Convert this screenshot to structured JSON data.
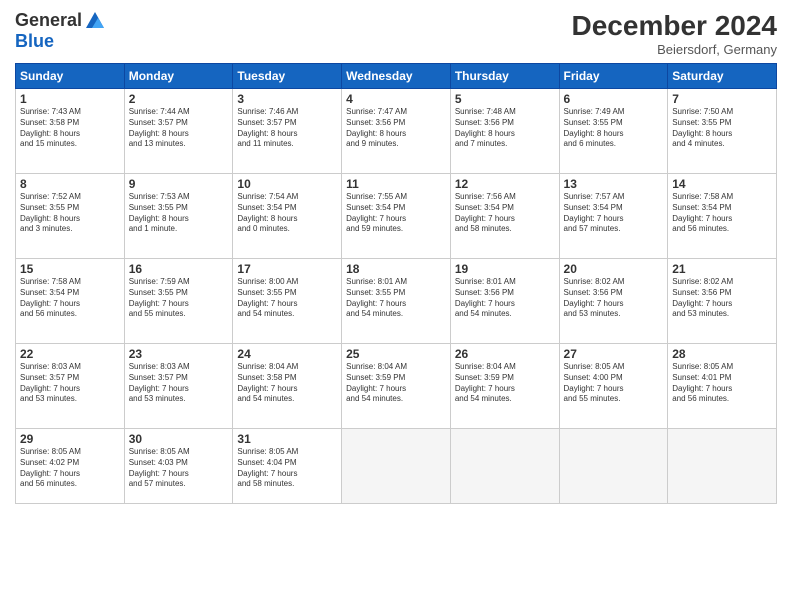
{
  "header": {
    "logo_general": "General",
    "logo_blue": "Blue",
    "month_title": "December 2024",
    "location": "Beiersdorf, Germany"
  },
  "weekdays": [
    "Sunday",
    "Monday",
    "Tuesday",
    "Wednesday",
    "Thursday",
    "Friday",
    "Saturday"
  ],
  "weeks": [
    [
      {
        "day": 1,
        "info": "Sunrise: 7:43 AM\nSunset: 3:58 PM\nDaylight: 8 hours\nand 15 minutes."
      },
      {
        "day": 2,
        "info": "Sunrise: 7:44 AM\nSunset: 3:57 PM\nDaylight: 8 hours\nand 13 minutes."
      },
      {
        "day": 3,
        "info": "Sunrise: 7:46 AM\nSunset: 3:57 PM\nDaylight: 8 hours\nand 11 minutes."
      },
      {
        "day": 4,
        "info": "Sunrise: 7:47 AM\nSunset: 3:56 PM\nDaylight: 8 hours\nand 9 minutes."
      },
      {
        "day": 5,
        "info": "Sunrise: 7:48 AM\nSunset: 3:56 PM\nDaylight: 8 hours\nand 7 minutes."
      },
      {
        "day": 6,
        "info": "Sunrise: 7:49 AM\nSunset: 3:55 PM\nDaylight: 8 hours\nand 6 minutes."
      },
      {
        "day": 7,
        "info": "Sunrise: 7:50 AM\nSunset: 3:55 PM\nDaylight: 8 hours\nand 4 minutes."
      }
    ],
    [
      {
        "day": 8,
        "info": "Sunrise: 7:52 AM\nSunset: 3:55 PM\nDaylight: 8 hours\nand 3 minutes."
      },
      {
        "day": 9,
        "info": "Sunrise: 7:53 AM\nSunset: 3:55 PM\nDaylight: 8 hours\nand 1 minute."
      },
      {
        "day": 10,
        "info": "Sunrise: 7:54 AM\nSunset: 3:54 PM\nDaylight: 8 hours\nand 0 minutes."
      },
      {
        "day": 11,
        "info": "Sunrise: 7:55 AM\nSunset: 3:54 PM\nDaylight: 7 hours\nand 59 minutes."
      },
      {
        "day": 12,
        "info": "Sunrise: 7:56 AM\nSunset: 3:54 PM\nDaylight: 7 hours\nand 58 minutes."
      },
      {
        "day": 13,
        "info": "Sunrise: 7:57 AM\nSunset: 3:54 PM\nDaylight: 7 hours\nand 57 minutes."
      },
      {
        "day": 14,
        "info": "Sunrise: 7:58 AM\nSunset: 3:54 PM\nDaylight: 7 hours\nand 56 minutes."
      }
    ],
    [
      {
        "day": 15,
        "info": "Sunrise: 7:58 AM\nSunset: 3:54 PM\nDaylight: 7 hours\nand 56 minutes."
      },
      {
        "day": 16,
        "info": "Sunrise: 7:59 AM\nSunset: 3:55 PM\nDaylight: 7 hours\nand 55 minutes."
      },
      {
        "day": 17,
        "info": "Sunrise: 8:00 AM\nSunset: 3:55 PM\nDaylight: 7 hours\nand 54 minutes."
      },
      {
        "day": 18,
        "info": "Sunrise: 8:01 AM\nSunset: 3:55 PM\nDaylight: 7 hours\nand 54 minutes."
      },
      {
        "day": 19,
        "info": "Sunrise: 8:01 AM\nSunset: 3:56 PM\nDaylight: 7 hours\nand 54 minutes."
      },
      {
        "day": 20,
        "info": "Sunrise: 8:02 AM\nSunset: 3:56 PM\nDaylight: 7 hours\nand 53 minutes."
      },
      {
        "day": 21,
        "info": "Sunrise: 8:02 AM\nSunset: 3:56 PM\nDaylight: 7 hours\nand 53 minutes."
      }
    ],
    [
      {
        "day": 22,
        "info": "Sunrise: 8:03 AM\nSunset: 3:57 PM\nDaylight: 7 hours\nand 53 minutes."
      },
      {
        "day": 23,
        "info": "Sunrise: 8:03 AM\nSunset: 3:57 PM\nDaylight: 7 hours\nand 53 minutes."
      },
      {
        "day": 24,
        "info": "Sunrise: 8:04 AM\nSunset: 3:58 PM\nDaylight: 7 hours\nand 54 minutes."
      },
      {
        "day": 25,
        "info": "Sunrise: 8:04 AM\nSunset: 3:59 PM\nDaylight: 7 hours\nand 54 minutes."
      },
      {
        "day": 26,
        "info": "Sunrise: 8:04 AM\nSunset: 3:59 PM\nDaylight: 7 hours\nand 54 minutes."
      },
      {
        "day": 27,
        "info": "Sunrise: 8:05 AM\nSunset: 4:00 PM\nDaylight: 7 hours\nand 55 minutes."
      },
      {
        "day": 28,
        "info": "Sunrise: 8:05 AM\nSunset: 4:01 PM\nDaylight: 7 hours\nand 56 minutes."
      }
    ],
    [
      {
        "day": 29,
        "info": "Sunrise: 8:05 AM\nSunset: 4:02 PM\nDaylight: 7 hours\nand 56 minutes."
      },
      {
        "day": 30,
        "info": "Sunrise: 8:05 AM\nSunset: 4:03 PM\nDaylight: 7 hours\nand 57 minutes."
      },
      {
        "day": 31,
        "info": "Sunrise: 8:05 AM\nSunset: 4:04 PM\nDaylight: 7 hours\nand 58 minutes."
      },
      null,
      null,
      null,
      null
    ]
  ]
}
